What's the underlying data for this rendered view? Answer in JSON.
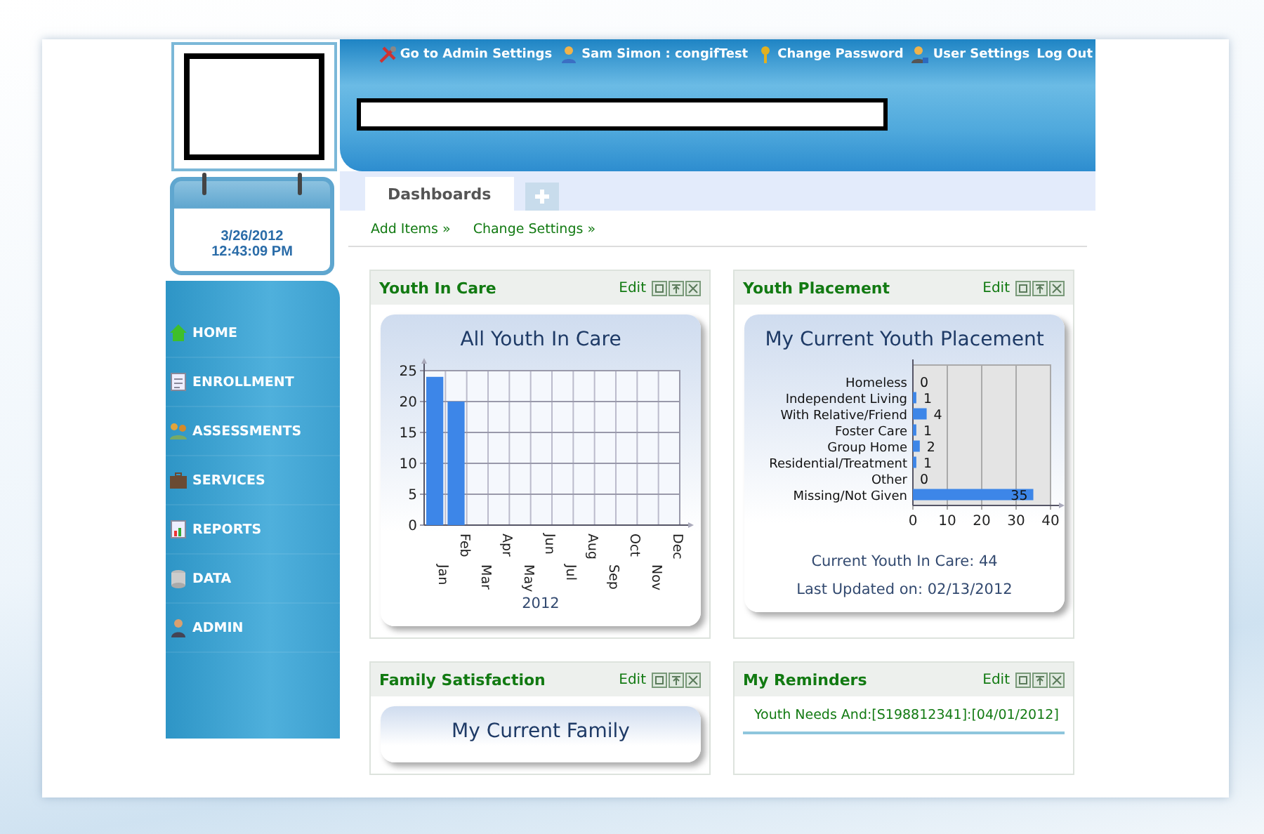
{
  "header": {
    "links": [
      {
        "kind": "tools",
        "label": "Go to Admin Settings"
      },
      {
        "kind": "user",
        "label": "Sam Simon : congifTest"
      },
      {
        "kind": "key",
        "label": "Change Password"
      },
      {
        "kind": "user-settings",
        "label": "User Settings"
      },
      {
        "kind": "plain",
        "label": "Log Out"
      }
    ]
  },
  "calendar": {
    "date": "3/26/2012",
    "time": "12:43:09 PM"
  },
  "sidebar": {
    "items": [
      {
        "kind": "home",
        "label": "HOME"
      },
      {
        "kind": "document",
        "label": "ENROLLMENT"
      },
      {
        "kind": "people",
        "label": "ASSESSMENTS"
      },
      {
        "kind": "briefcase",
        "label": "SERVICES"
      },
      {
        "kind": "report",
        "label": "REPORTS"
      },
      {
        "kind": "database",
        "label": "DATA"
      },
      {
        "kind": "person",
        "label": "ADMIN"
      }
    ]
  },
  "tabs": [
    {
      "kind": "text",
      "label": "Dashboards",
      "selected": true
    },
    {
      "kind": "add",
      "selected": false
    }
  ],
  "actions": [
    "Add Items »",
    "Change Settings »"
  ],
  "widgets": [
    {
      "title": "Youth In Care",
      "edit": "Edit",
      "chart_data": {
        "type": "bar",
        "title": "All Youth In Care",
        "xlabel": "2012",
        "categories": [
          "Jan",
          "Feb",
          "Mar",
          "Apr",
          "May",
          "Jun",
          "Jul",
          "Aug",
          "Sep",
          "Oct",
          "Nov",
          "Dec"
        ],
        "series": [
          {
            "color": "#3d86e8",
            "values": [
              24,
              20,
              null,
              null,
              null,
              null,
              null,
              null,
              null,
              null,
              null,
              null
            ]
          }
        ],
        "ylim": [
          0,
          25
        ],
        "yticks": [
          0,
          5,
          10,
          15,
          20,
          25
        ],
        "grid": true
      }
    },
    {
      "title": "Youth Placement",
      "edit": "Edit",
      "chart_data": {
        "type": "bar",
        "orientation": "horizontal",
        "title": "My Current Youth Placement",
        "categories": [
          "Homeless",
          "Independent Living",
          "With Relative/Friend",
          "Foster Care",
          "Group Home",
          "Residential/Treatment",
          "Other",
          "Missing/Not Given"
        ],
        "series": [
          {
            "color": "#3d86e8",
            "values": [
              0,
              1,
              4,
              1,
              2,
              1,
              0,
              35
            ]
          }
        ],
        "xlim": [
          0,
          40
        ],
        "xticks": [
          0,
          10,
          20,
          30,
          40
        ],
        "data_labels": true,
        "grid": true
      },
      "notes": [
        "Current Youth In Care: 44",
        "Last Updated on: 02/13/2012"
      ]
    },
    {
      "title": "Family Satisfaction",
      "edit": "Edit",
      "card_title": "My Current Family"
    },
    {
      "title": "My Reminders",
      "edit": "Edit",
      "reminders": [
        "Youth Needs And:[S198812341]:[04/01/2012]"
      ]
    }
  ]
}
